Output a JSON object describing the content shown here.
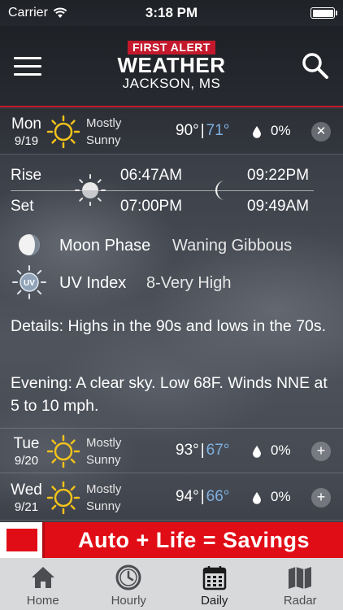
{
  "status_bar": {
    "carrier": "Carrier",
    "time": "3:18 PM"
  },
  "header": {
    "logo_top": "FIRST ALERT",
    "logo_main": "WEATHER",
    "city": "JACKSON, MS"
  },
  "expanded_day": {
    "day": "Mon",
    "date": "9/19",
    "condition_line1": "Mostly",
    "condition_line2": "Sunny",
    "high": "90°",
    "separator": "|",
    "low": "71°",
    "precip": "0%",
    "close_symbol": "✕",
    "rise_label": "Rise",
    "set_label": "Set",
    "sunrise": "06:47AM",
    "sunset": "07:00PM",
    "moonrise": "09:22PM",
    "moonset": "09:49AM",
    "moon_phase_label": "Moon Phase",
    "moon_phase_value": "Waning Gibbous",
    "uv_label": "UV Index",
    "uv_value": "8-Very High",
    "uv_icon_text": "UV",
    "details": "Details: Highs in the 90s and lows in the 70s.",
    "evening": "Evening: A clear sky. Low 68F. Winds NNE at 5 to 10 mph."
  },
  "forecast_rows": [
    {
      "day": "Tue",
      "date": "9/20",
      "condition_line1": "Mostly",
      "condition_line2": "Sunny",
      "high": "93°",
      "separator": "|",
      "low": "67°",
      "precip": "0%",
      "expand_symbol": "+"
    },
    {
      "day": "Wed",
      "date": "9/21",
      "condition_line1": "Mostly",
      "condition_line2": "Sunny",
      "high": "94°",
      "separator": "|",
      "low": "66°",
      "precip": "0%",
      "expand_symbol": "+"
    }
  ],
  "ad": {
    "text": "Auto + Life = Savings"
  },
  "tabs": [
    {
      "label": "Home",
      "icon": "home-icon"
    },
    {
      "label": "Hourly",
      "icon": "clock-icon"
    },
    {
      "label": "Daily",
      "icon": "calendar-icon",
      "active": true
    },
    {
      "label": "Radar",
      "icon": "map-icon"
    }
  ],
  "colors": {
    "accent_red": "#c4192c",
    "low_temp_blue": "#7fb0e0",
    "sun_yellow": "#f2c21b",
    "tab_bar": "#d8d9db"
  }
}
